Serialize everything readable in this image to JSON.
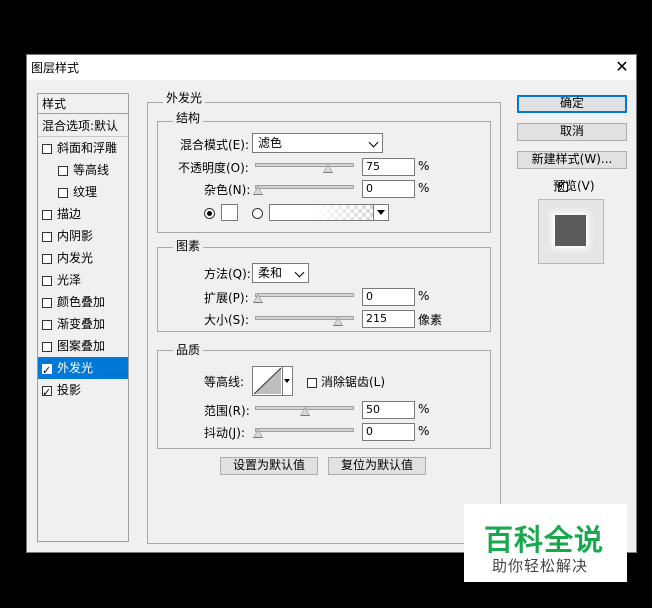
{
  "window": {
    "title": "图层样式",
    "close_glyph": "✕"
  },
  "left_list": {
    "header": "样式",
    "blend_options": "混合选项:默认",
    "items": [
      {
        "label": "斜面和浮雕",
        "checked": false,
        "indent": false
      },
      {
        "label": "等高线",
        "checked": false,
        "indent": true
      },
      {
        "label": "纹理",
        "checked": false,
        "indent": true
      },
      {
        "label": "描边",
        "checked": false,
        "indent": false
      },
      {
        "label": "内阴影",
        "checked": false,
        "indent": false
      },
      {
        "label": "内发光",
        "checked": false,
        "indent": false
      },
      {
        "label": "光泽",
        "checked": false,
        "indent": false
      },
      {
        "label": "颜色叠加",
        "checked": false,
        "indent": false
      },
      {
        "label": "渐变叠加",
        "checked": false,
        "indent": false
      },
      {
        "label": "图案叠加",
        "checked": false,
        "indent": false
      },
      {
        "label": "外发光",
        "checked": true,
        "indent": false,
        "selected": true
      },
      {
        "label": "投影",
        "checked": true,
        "indent": false
      }
    ]
  },
  "outer_glow": {
    "title": "外发光",
    "structure": {
      "title": "结构",
      "blend_mode_label": "混合模式(E):",
      "blend_mode_value": "滤色",
      "opacity_label": "不透明度(O):",
      "opacity_value": "75",
      "opacity_level": 0.75,
      "noise_label": "杂色(N):",
      "noise_value": "0",
      "noise_level": 0,
      "percent": "%"
    },
    "elements": {
      "title": "图素",
      "method_label": "方法(Q):",
      "method_value": "柔和",
      "spread_label": "扩展(P):",
      "spread_value": "0",
      "spread_level": 0,
      "size_label": "大小(S):",
      "size_value": "215",
      "size_level": 0.86,
      "size_unit": "像素",
      "percent": "%"
    },
    "quality": {
      "title": "品质",
      "contour_label": "等高线:",
      "anti_alias_label": "消除锯齿(L)",
      "range_label": "范围(R):",
      "range_value": "50",
      "range_level": 0.5,
      "jitter_label": "抖动(J):",
      "jitter_value": "0",
      "jitter_level": 0,
      "percent": "%"
    },
    "make_default": "设置为默认值",
    "reset_default": "复位为默认值"
  },
  "right_buttons": {
    "ok": "确定",
    "cancel": "取消",
    "new_style": "新建样式(W)...",
    "preview_label": "预览(V)",
    "preview_checked": true
  },
  "watermark": {
    "title": "百科全说",
    "subtitle": "助你轻松解决"
  },
  "colors": {
    "accent": "#0078d7",
    "watermark_green": "#1aa84f"
  }
}
